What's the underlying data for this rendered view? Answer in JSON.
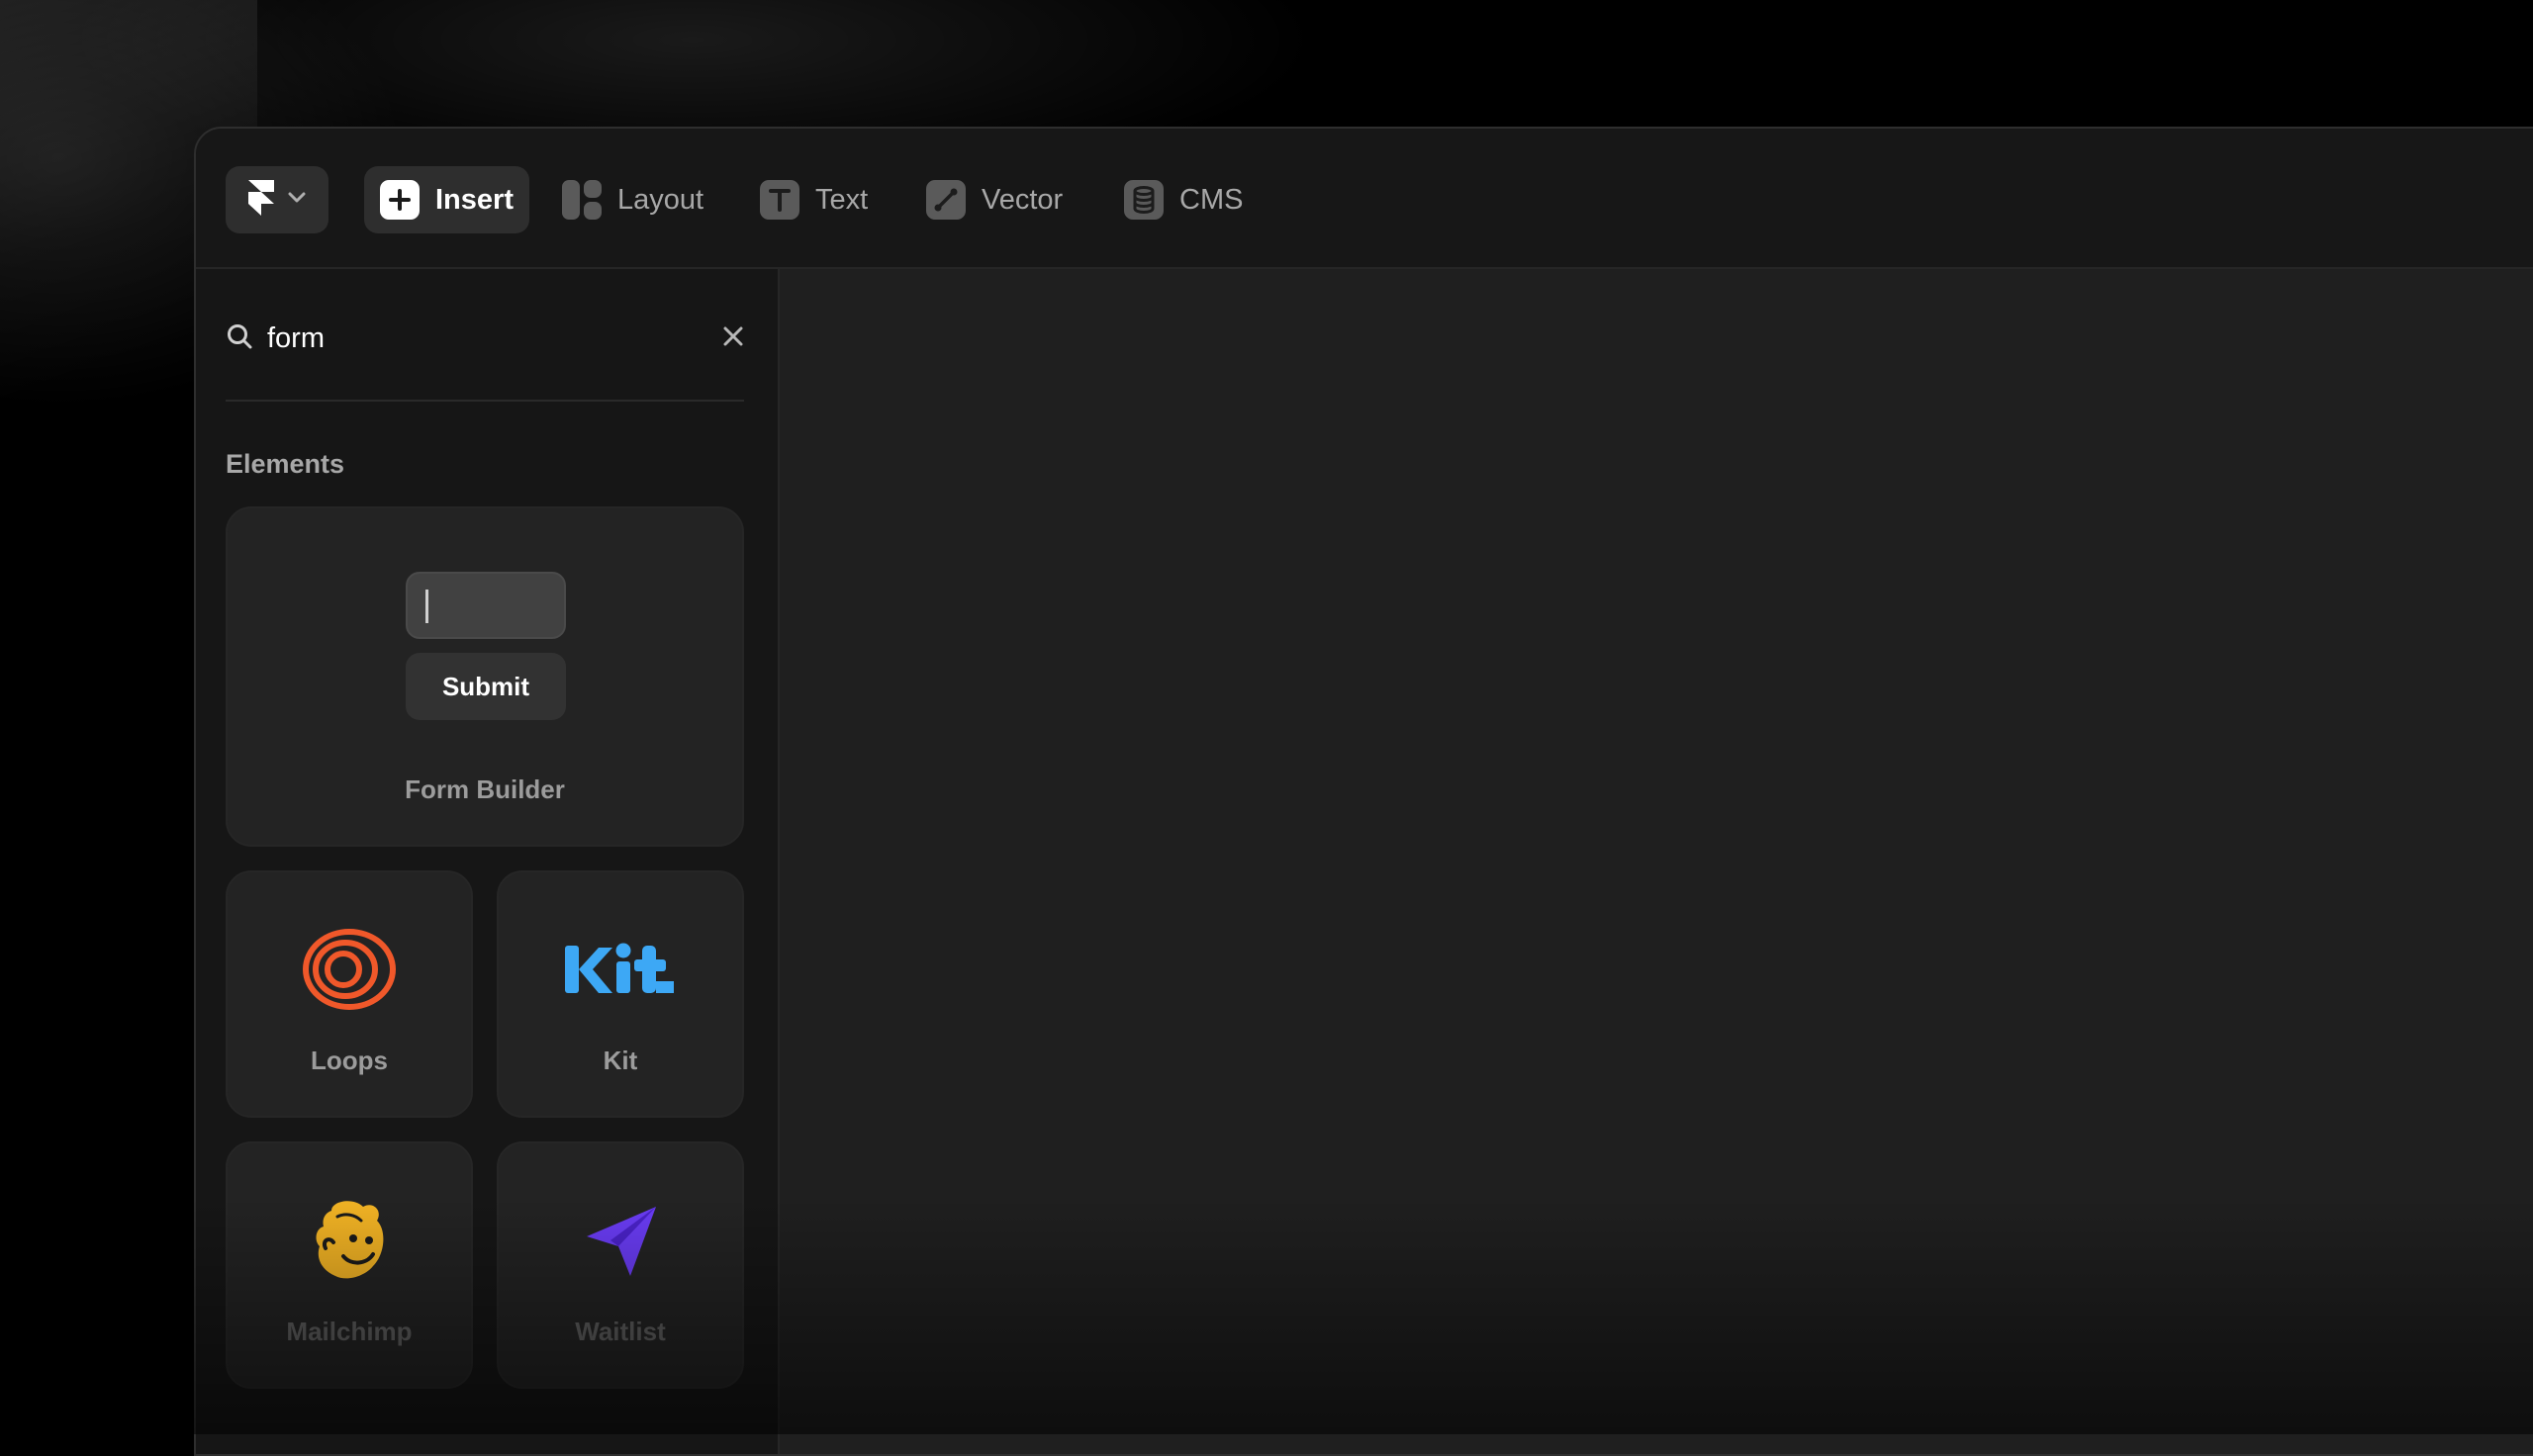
{
  "toolbar": {
    "items": [
      {
        "label": "Insert",
        "icon": "plus-icon",
        "active": true
      },
      {
        "label": "Layout",
        "icon": "layout-icon"
      },
      {
        "label": "Text",
        "icon": "text-icon"
      },
      {
        "label": "Vector",
        "icon": "pen-icon"
      },
      {
        "label": "CMS",
        "icon": "database-icon"
      }
    ]
  },
  "search": {
    "value": "form"
  },
  "section": {
    "title": "Elements"
  },
  "form_builder": {
    "submit_label": "Submit",
    "label": "Form Builder"
  },
  "cards": [
    {
      "label": "Loops",
      "color": "#f0582a"
    },
    {
      "label": "Kit",
      "color": "#3da8f5"
    },
    {
      "label": "Mailchimp",
      "color": "#f2b324"
    },
    {
      "label": "Waitlist",
      "color": "#6a3cf5"
    }
  ]
}
